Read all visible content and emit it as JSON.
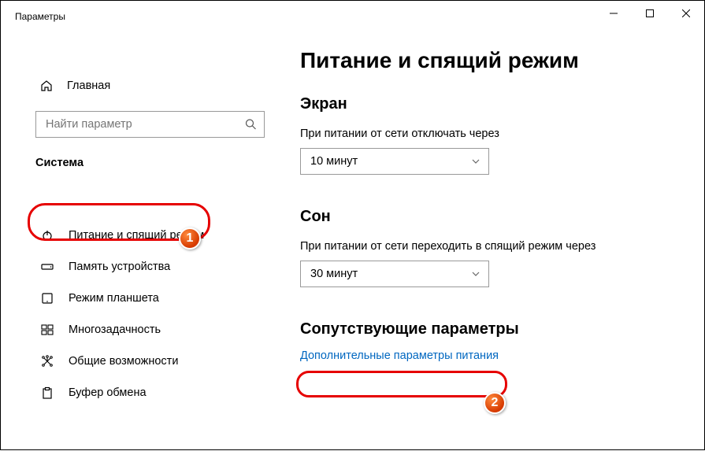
{
  "window": {
    "title": "Параметры"
  },
  "sidebar": {
    "home_label": "Главная",
    "search_placeholder": "Найти параметр",
    "section_label": "Система",
    "items": [
      {
        "label": "Питание и спящий режим"
      },
      {
        "label": "Память устройства"
      },
      {
        "label": "Режим планшета"
      },
      {
        "label": "Многозадачность"
      },
      {
        "label": "Общие возможности"
      },
      {
        "label": "Буфер обмена"
      }
    ]
  },
  "main": {
    "title": "Питание и спящий режим",
    "screen": {
      "heading": "Экран",
      "label": "При питании от сети отключать через",
      "value": "10 минут"
    },
    "sleep": {
      "heading": "Сон",
      "label": "При питании от сети переходить в спящий режим через",
      "value": "30 минут"
    },
    "related": {
      "heading": "Сопутствующие параметры",
      "link": "Дополнительные параметры питания"
    }
  },
  "annotations": {
    "badge1": "1",
    "badge2": "2"
  }
}
